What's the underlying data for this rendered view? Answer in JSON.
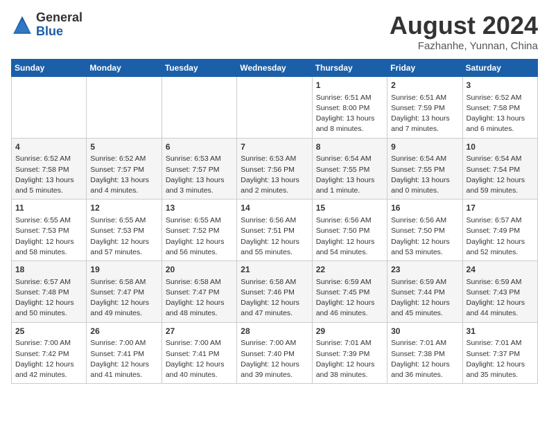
{
  "header": {
    "logo_general": "General",
    "logo_blue": "Blue",
    "month_title": "August 2024",
    "location": "Fazhanhe, Yunnan, China"
  },
  "days_of_week": [
    "Sunday",
    "Monday",
    "Tuesday",
    "Wednesday",
    "Thursday",
    "Friday",
    "Saturday"
  ],
  "weeks": [
    [
      {
        "day": "",
        "info": ""
      },
      {
        "day": "",
        "info": ""
      },
      {
        "day": "",
        "info": ""
      },
      {
        "day": "",
        "info": ""
      },
      {
        "day": "1",
        "info": "Sunrise: 6:51 AM\nSunset: 8:00 PM\nDaylight: 13 hours\nand 8 minutes."
      },
      {
        "day": "2",
        "info": "Sunrise: 6:51 AM\nSunset: 7:59 PM\nDaylight: 13 hours\nand 7 minutes."
      },
      {
        "day": "3",
        "info": "Sunrise: 6:52 AM\nSunset: 7:58 PM\nDaylight: 13 hours\nand 6 minutes."
      }
    ],
    [
      {
        "day": "4",
        "info": "Sunrise: 6:52 AM\nSunset: 7:58 PM\nDaylight: 13 hours\nand 5 minutes."
      },
      {
        "day": "5",
        "info": "Sunrise: 6:52 AM\nSunset: 7:57 PM\nDaylight: 13 hours\nand 4 minutes."
      },
      {
        "day": "6",
        "info": "Sunrise: 6:53 AM\nSunset: 7:57 PM\nDaylight: 13 hours\nand 3 minutes."
      },
      {
        "day": "7",
        "info": "Sunrise: 6:53 AM\nSunset: 7:56 PM\nDaylight: 13 hours\nand 2 minutes."
      },
      {
        "day": "8",
        "info": "Sunrise: 6:54 AM\nSunset: 7:55 PM\nDaylight: 13 hours\nand 1 minute."
      },
      {
        "day": "9",
        "info": "Sunrise: 6:54 AM\nSunset: 7:55 PM\nDaylight: 13 hours\nand 0 minutes."
      },
      {
        "day": "10",
        "info": "Sunrise: 6:54 AM\nSunset: 7:54 PM\nDaylight: 12 hours\nand 59 minutes."
      }
    ],
    [
      {
        "day": "11",
        "info": "Sunrise: 6:55 AM\nSunset: 7:53 PM\nDaylight: 12 hours\nand 58 minutes."
      },
      {
        "day": "12",
        "info": "Sunrise: 6:55 AM\nSunset: 7:53 PM\nDaylight: 12 hours\nand 57 minutes."
      },
      {
        "day": "13",
        "info": "Sunrise: 6:55 AM\nSunset: 7:52 PM\nDaylight: 12 hours\nand 56 minutes."
      },
      {
        "day": "14",
        "info": "Sunrise: 6:56 AM\nSunset: 7:51 PM\nDaylight: 12 hours\nand 55 minutes."
      },
      {
        "day": "15",
        "info": "Sunrise: 6:56 AM\nSunset: 7:50 PM\nDaylight: 12 hours\nand 54 minutes."
      },
      {
        "day": "16",
        "info": "Sunrise: 6:56 AM\nSunset: 7:50 PM\nDaylight: 12 hours\nand 53 minutes."
      },
      {
        "day": "17",
        "info": "Sunrise: 6:57 AM\nSunset: 7:49 PM\nDaylight: 12 hours\nand 52 minutes."
      }
    ],
    [
      {
        "day": "18",
        "info": "Sunrise: 6:57 AM\nSunset: 7:48 PM\nDaylight: 12 hours\nand 50 minutes."
      },
      {
        "day": "19",
        "info": "Sunrise: 6:58 AM\nSunset: 7:47 PM\nDaylight: 12 hours\nand 49 minutes."
      },
      {
        "day": "20",
        "info": "Sunrise: 6:58 AM\nSunset: 7:47 PM\nDaylight: 12 hours\nand 48 minutes."
      },
      {
        "day": "21",
        "info": "Sunrise: 6:58 AM\nSunset: 7:46 PM\nDaylight: 12 hours\nand 47 minutes."
      },
      {
        "day": "22",
        "info": "Sunrise: 6:59 AM\nSunset: 7:45 PM\nDaylight: 12 hours\nand 46 minutes."
      },
      {
        "day": "23",
        "info": "Sunrise: 6:59 AM\nSunset: 7:44 PM\nDaylight: 12 hours\nand 45 minutes."
      },
      {
        "day": "24",
        "info": "Sunrise: 6:59 AM\nSunset: 7:43 PM\nDaylight: 12 hours\nand 44 minutes."
      }
    ],
    [
      {
        "day": "25",
        "info": "Sunrise: 7:00 AM\nSunset: 7:42 PM\nDaylight: 12 hours\nand 42 minutes."
      },
      {
        "day": "26",
        "info": "Sunrise: 7:00 AM\nSunset: 7:41 PM\nDaylight: 12 hours\nand 41 minutes."
      },
      {
        "day": "27",
        "info": "Sunrise: 7:00 AM\nSunset: 7:41 PM\nDaylight: 12 hours\nand 40 minutes."
      },
      {
        "day": "28",
        "info": "Sunrise: 7:00 AM\nSunset: 7:40 PM\nDaylight: 12 hours\nand 39 minutes."
      },
      {
        "day": "29",
        "info": "Sunrise: 7:01 AM\nSunset: 7:39 PM\nDaylight: 12 hours\nand 38 minutes."
      },
      {
        "day": "30",
        "info": "Sunrise: 7:01 AM\nSunset: 7:38 PM\nDaylight: 12 hours\nand 36 minutes."
      },
      {
        "day": "31",
        "info": "Sunrise: 7:01 AM\nSunset: 7:37 PM\nDaylight: 12 hours\nand 35 minutes."
      }
    ]
  ]
}
